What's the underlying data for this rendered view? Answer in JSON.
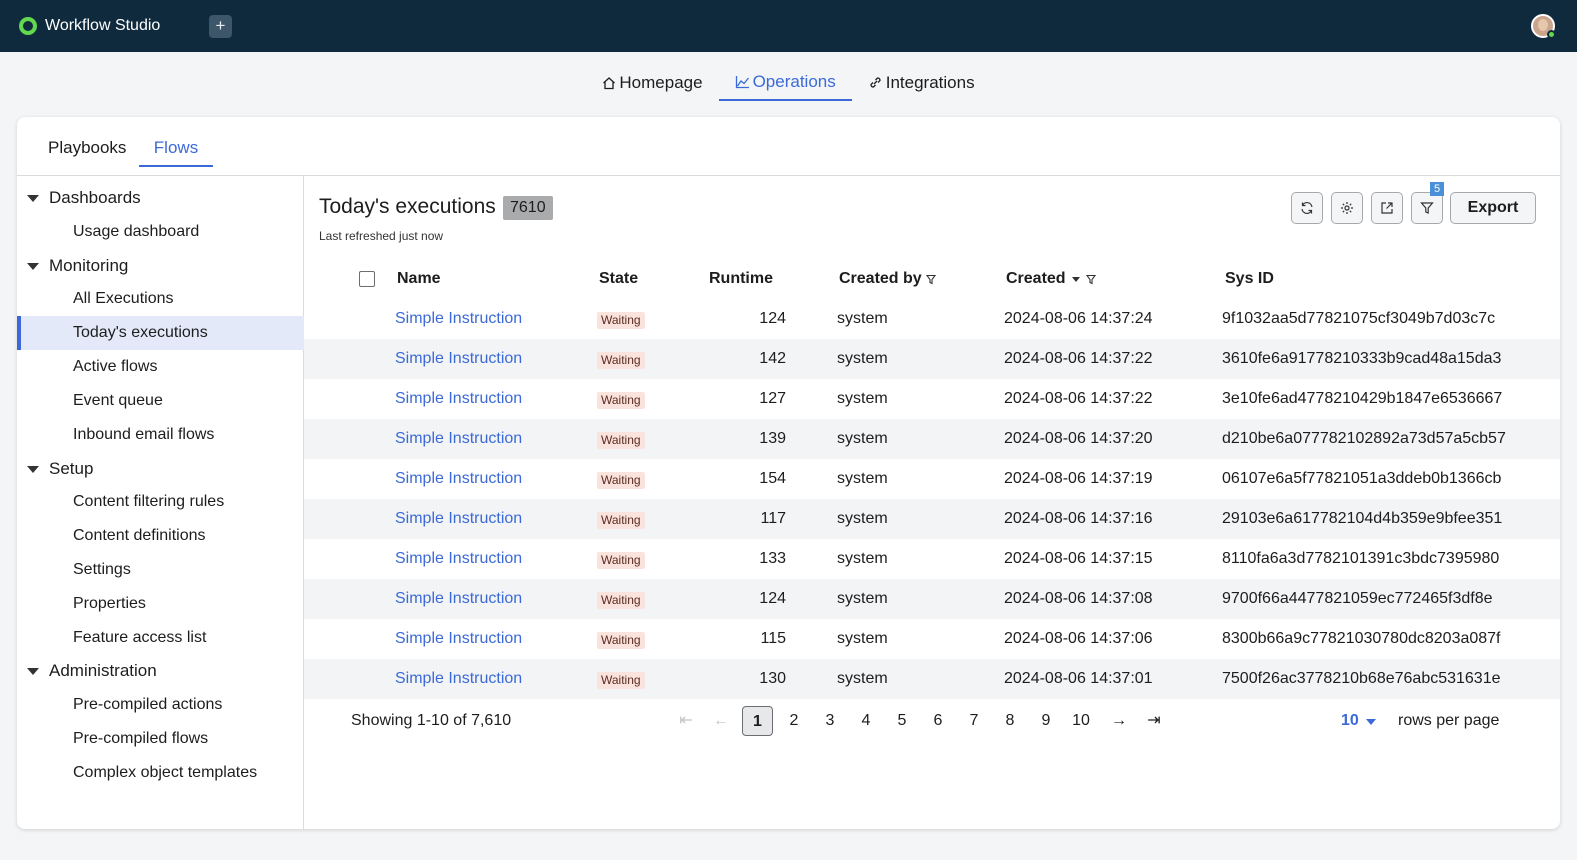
{
  "app": {
    "name": "Workflow Studio",
    "new_tab": "+"
  },
  "main_nav": [
    {
      "label": "Homepage",
      "icon": "home-icon"
    },
    {
      "label": "Operations",
      "icon": "chart-icon",
      "active": true
    },
    {
      "label": "Integrations",
      "icon": "link-icon"
    }
  ],
  "sub_tabs": [
    {
      "label": "Playbooks"
    },
    {
      "label": "Flows",
      "active": true
    }
  ],
  "sidebar": {
    "groups": [
      {
        "label": "Dashboards",
        "items": [
          "Usage dashboard"
        ]
      },
      {
        "label": "Monitoring",
        "items": [
          "All Executions",
          "Today's executions",
          "Active flows",
          "Event queue",
          "Inbound email flows"
        ]
      },
      {
        "label": "Setup",
        "items": [
          "Content filtering rules",
          "Content definitions",
          "Settings",
          "Properties",
          "Feature access list"
        ]
      },
      {
        "label": "Administration",
        "items": [
          "Pre-compiled actions",
          "Pre-compiled flows",
          "Complex object templates"
        ]
      }
    ],
    "active_item": "Today's executions"
  },
  "page": {
    "title": "Today's executions",
    "count": "7610",
    "last_refreshed": "Last refreshed just now",
    "filter_count": "5",
    "export_label": "Export"
  },
  "table": {
    "columns": [
      "Name",
      "State",
      "Runtime",
      "Created by",
      "Created",
      "Sys ID"
    ],
    "rows": [
      {
        "name": "Simple Instruction",
        "state": "Waiting",
        "runtime": "124",
        "created_by": "system",
        "created": "2024-08-06 14:37:24",
        "sys_id": "9f1032aa5d77821075cf3049b7d03c7c"
      },
      {
        "name": "Simple Instruction",
        "state": "Waiting",
        "runtime": "142",
        "created_by": "system",
        "created": "2024-08-06 14:37:22",
        "sys_id": "3610fe6a91778210333b9cad48a15da3"
      },
      {
        "name": "Simple Instruction",
        "state": "Waiting",
        "runtime": "127",
        "created_by": "system",
        "created": "2024-08-06 14:37:22",
        "sys_id": "3e10fe6ad4778210429b1847e6536667"
      },
      {
        "name": "Simple Instruction",
        "state": "Waiting",
        "runtime": "139",
        "created_by": "system",
        "created": "2024-08-06 14:37:20",
        "sys_id": "d210be6a077782102892a73d57a5cb57"
      },
      {
        "name": "Simple Instruction",
        "state": "Waiting",
        "runtime": "154",
        "created_by": "system",
        "created": "2024-08-06 14:37:19",
        "sys_id": "06107e6a5f77821051a3ddeb0b1366cb"
      },
      {
        "name": "Simple Instruction",
        "state": "Waiting",
        "runtime": "117",
        "created_by": "system",
        "created": "2024-08-06 14:37:16",
        "sys_id": "29103e6a617782104d4b359e9bfee351"
      },
      {
        "name": "Simple Instruction",
        "state": "Waiting",
        "runtime": "133",
        "created_by": "system",
        "created": "2024-08-06 14:37:15",
        "sys_id": "8110fa6a3d7782101391c3bdc7395980"
      },
      {
        "name": "Simple Instruction",
        "state": "Waiting",
        "runtime": "124",
        "created_by": "system",
        "created": "2024-08-06 14:37:08",
        "sys_id": "9700f66a4477821059ec772465f3df8e"
      },
      {
        "name": "Simple Instruction",
        "state": "Waiting",
        "runtime": "115",
        "created_by": "system",
        "created": "2024-08-06 14:37:06",
        "sys_id": "8300b66a9c77821030780dc8203a087f"
      },
      {
        "name": "Simple Instruction",
        "state": "Waiting",
        "runtime": "130",
        "created_by": "system",
        "created": "2024-08-06 14:37:01",
        "sys_id": "7500f26ac3778210b68e76abc531631e"
      }
    ]
  },
  "pagination": {
    "showing": "Showing 1-10 of 7,610",
    "pages": [
      "1",
      "2",
      "3",
      "4",
      "5",
      "6",
      "7",
      "8",
      "9",
      "10"
    ],
    "current_page": "1",
    "first": "⇤",
    "prev": "←",
    "next": "→",
    "last": "⇥",
    "rows_per_page_value": "10",
    "rows_per_page_label": "rows per page"
  },
  "colors": {
    "topbar": "#0f2a3d",
    "accent": "#3b6ad8",
    "brand_green": "#62d84e",
    "waiting_bg": "#fbe3dd"
  }
}
